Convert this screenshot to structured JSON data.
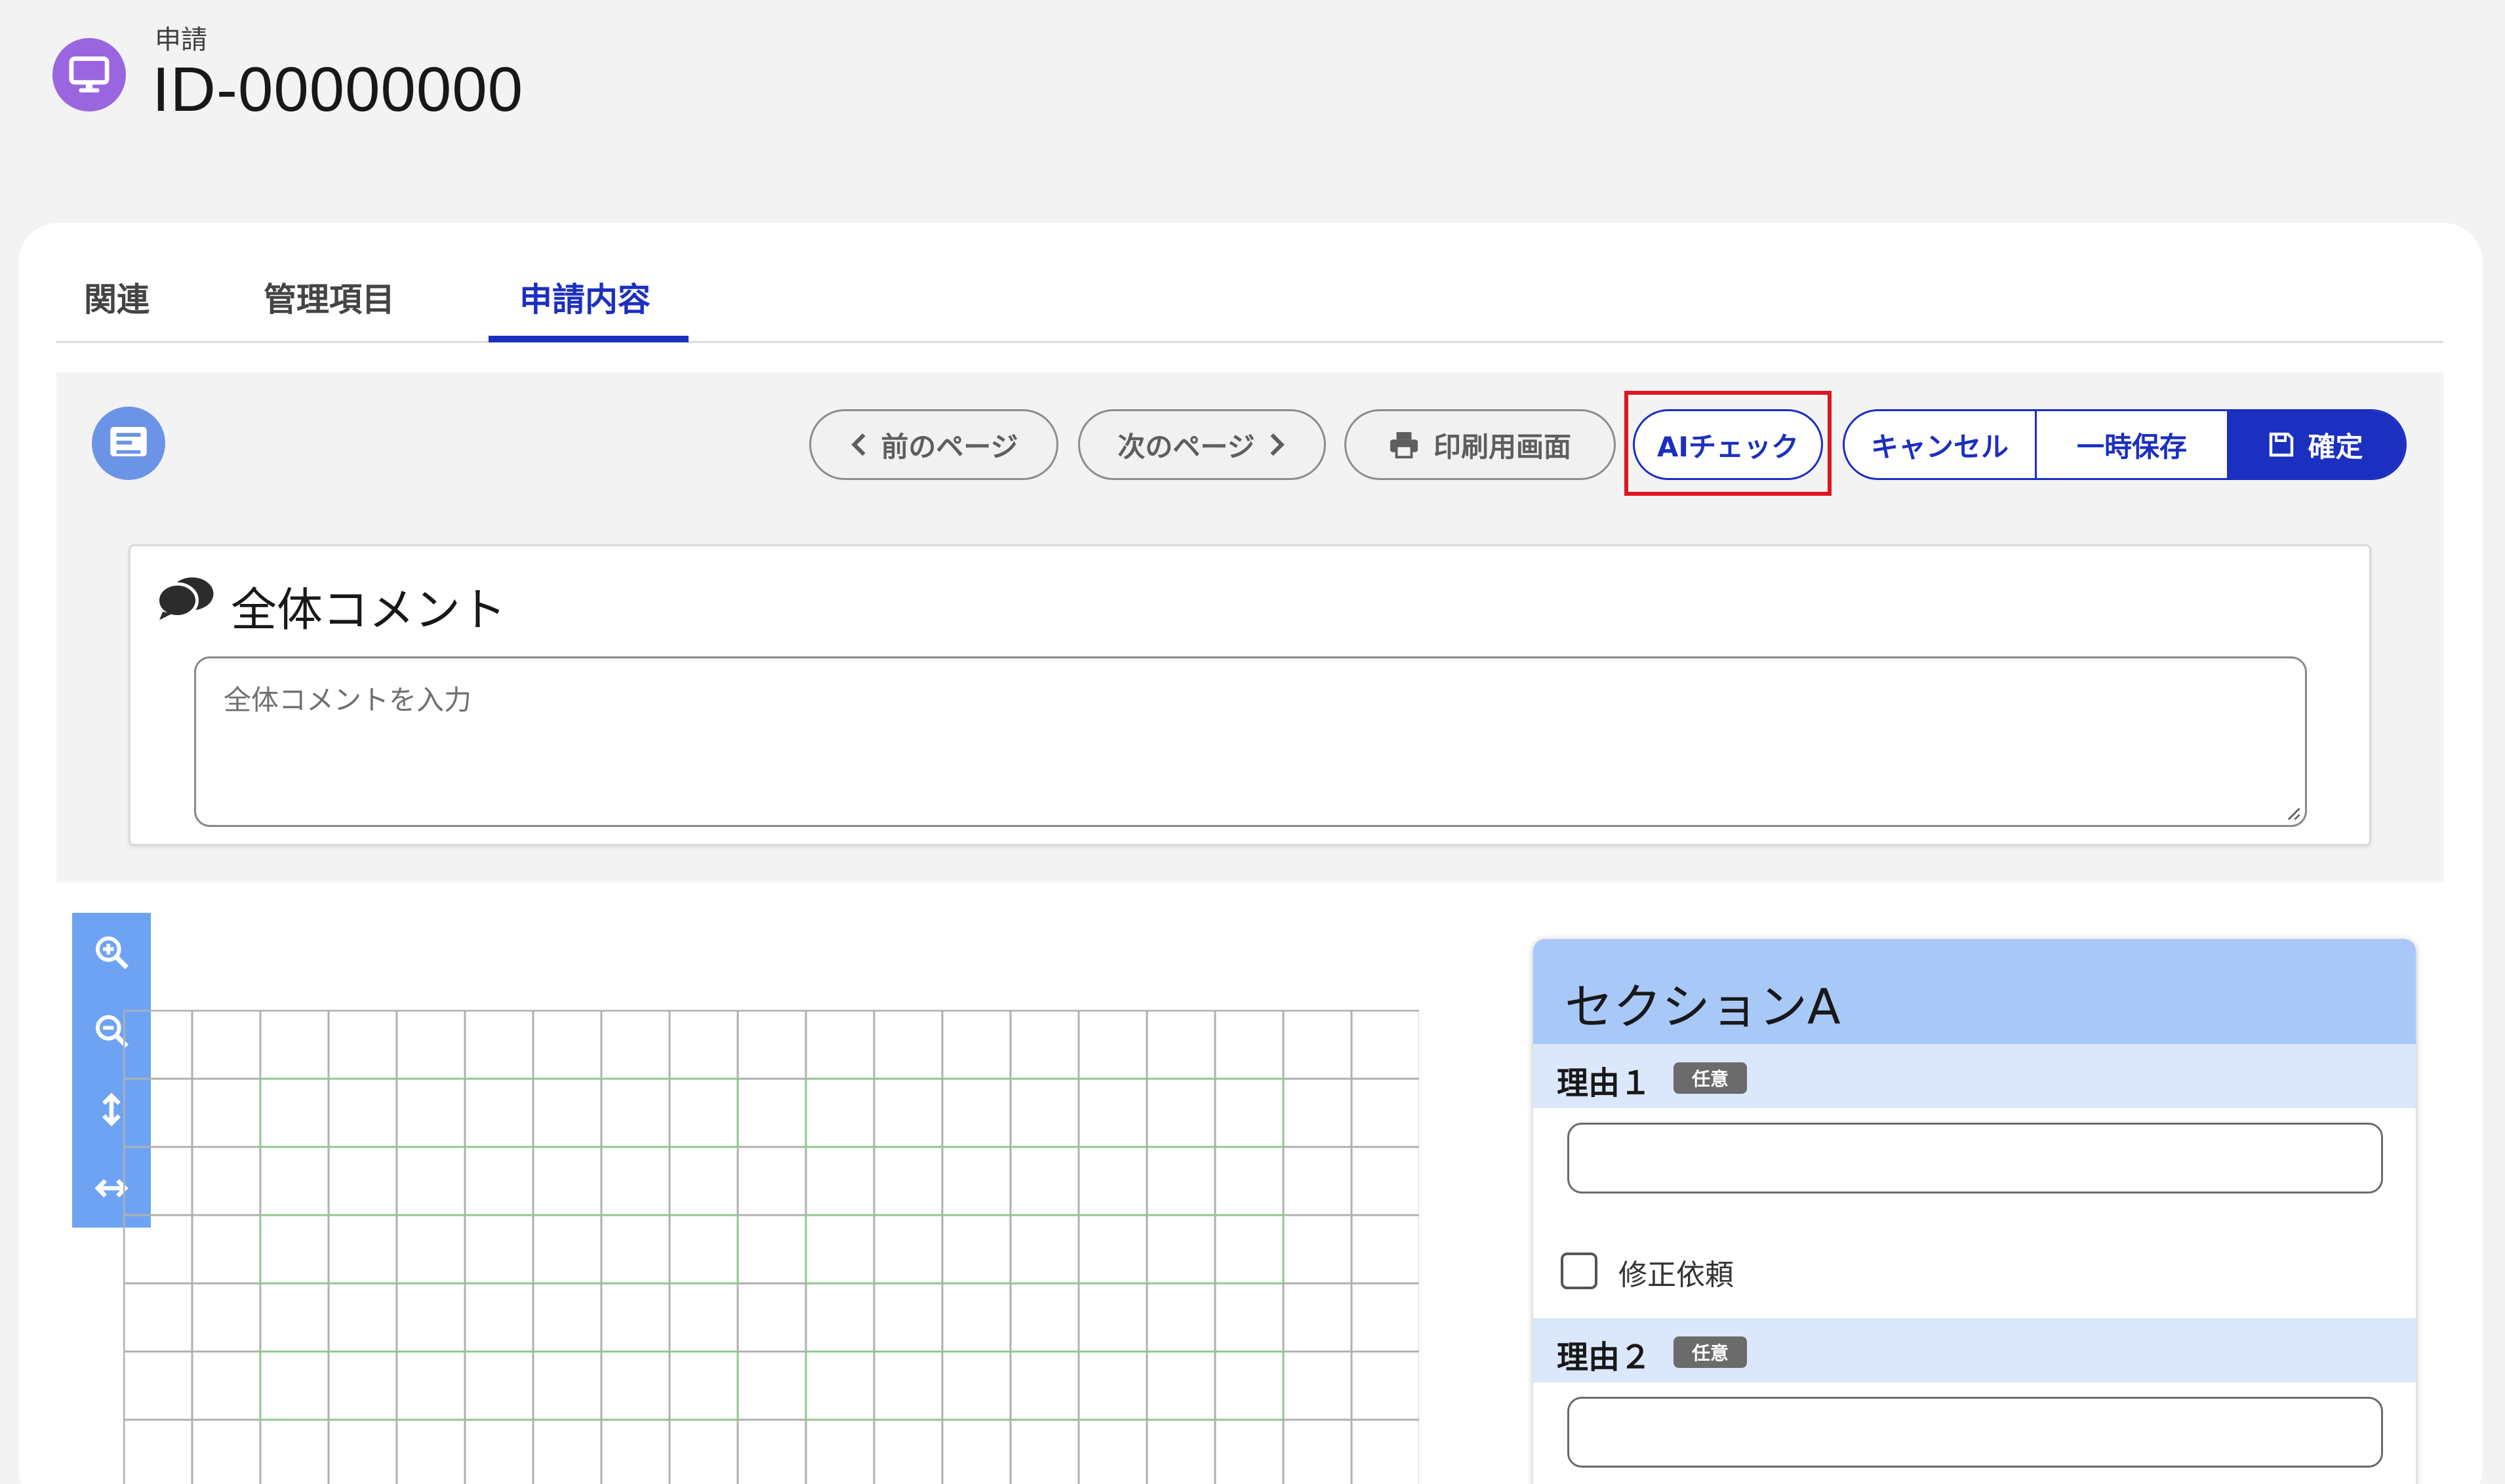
{
  "header": {
    "kicker": "申請",
    "title": "ID-00000000",
    "icon": "monitor-icon",
    "icon_color": "#9a66e0"
  },
  "tabs": [
    {
      "label": "関連",
      "active": false
    },
    {
      "label": "管理項目",
      "active": false
    },
    {
      "label": "申請内容",
      "active": true
    }
  ],
  "toolbar": {
    "prev_label": "前のページ",
    "next_label": "次のページ",
    "print_label": "印刷用画面",
    "ai_check_label": "AIチェック",
    "cancel_label": "キャンセル",
    "temp_save_label": "一時保存",
    "confirm_label": "確定",
    "accent_color": "#1b2fc0",
    "highlight_color": "#e0141e"
  },
  "comment": {
    "title": "全体コメント",
    "placeholder": "全体コメントを入力",
    "value": ""
  },
  "zoom_tools": [
    "zoom-in-icon",
    "zoom-out-icon",
    "fit-height-icon",
    "fit-width-icon"
  ],
  "section": {
    "title": "セクションA",
    "fields": [
      {
        "label": "理由１",
        "badge": "任意",
        "value": ""
      },
      {
        "label": "理由２",
        "badge": "任意",
        "value": ""
      }
    ],
    "checkbox_label": "修正依頼",
    "checkbox_checked": false,
    "header_color": "#a8c8f8"
  }
}
